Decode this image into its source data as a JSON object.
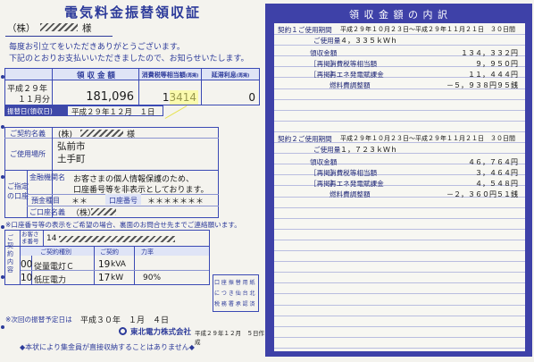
{
  "left": {
    "title": "電気料金振替領収証",
    "addressee_prefix": "（株）",
    "addressee_suffix": "様",
    "greeting_1": "毎度お引立てをいただきありがとうございます。",
    "greeting_2": "下記のとおりお支払いいただきましたので、お知らせいたします。",
    "table_headers": [
      "領 収 金 額",
      "消費税等相当額",
      "延滞利息"
    ],
    "table_header_small": [
      "(再掲)",
      "(再掲)"
    ],
    "period_year": "平成２９年",
    "period_month": "１１月分",
    "amount": "181,096",
    "tax": "13414",
    "late_interest": "0",
    "transfer_date_label": "振替日(領収日)",
    "transfer_date": "平成２９年１２月　１日",
    "contract_name_label": "ご契約名義",
    "contract_name": "(株)",
    "contract_name_suffix": "様",
    "usage_place_label": "ご使用場所",
    "usage_place_1": "弘前市",
    "usage_place_2": "土手町",
    "account_section_label": "ご指定の口座",
    "bank_label": "金融機関名",
    "privacy_note_1": "お客さまの個人情報保護のため、",
    "privacy_note_2": "口座番号等を非表示としております。",
    "deposit_type_label": "預金種目",
    "deposit_type": "＊＊",
    "account_number_label": "口座番号",
    "account_number": "＊＊＊＊＊＊＊",
    "holder_label": "ご口座名義",
    "holder": "（株）",
    "account_note": "※口座番号等の表示をご希望の場合、裏面のお問合せ先までご連絡願います。",
    "customer_number_label": "お客さま番号",
    "customer_number": "14",
    "contract_label": "ご契約内容",
    "contract_headers": [
      "ご契約種別",
      "ご契約",
      "力率"
    ],
    "contract_rows": [
      {
        "no": "00",
        "type": "従量電灯Ｃ",
        "amount": "19",
        "unit": "kVA",
        "pf": ""
      },
      {
        "no": "10",
        "type": "低圧電力",
        "amount": "17",
        "unit": "kW",
        "pf": "90%"
      }
    ],
    "stamp_lines": [
      "口 座 振 替 用 紙",
      "に つ き 仙 台 北",
      "税 務 署 承 認 済"
    ],
    "next_date_label": "※次回の振替予定日は",
    "next_date": "平成３０年　１月　４日",
    "company": "東北電力株式会社",
    "issued": "平成２９年１２月　５日作成",
    "bottom_note": "◆本状により集金員が直接収納することはありません◆"
  },
  "right": {
    "title": "領 収 金 額 の 内 訳",
    "contract1": {
      "period_label": "契約１ご使用期間",
      "period": "平成２９年１０月２３日～平成２９年１１月２１日　３０日間",
      "usage_label": "ご使用量",
      "usage": "４，３３５ｋＷｈ",
      "amount_label": "領収金額",
      "amount": "１３４，３３２円",
      "tax_label": "消費税等相当額",
      "tax": "９，９５０円",
      "renew_label": "再エネ発電賦課金",
      "renew": "１１，４４４円",
      "fuel_label": "燃料費調整額",
      "fuel": "－５，９３８円９５銭",
      "repeat": "［再掲］"
    },
    "contract2": {
      "period_label": "契約２ご使用期間",
      "period": "平成２９年１０月２３日～平成２９年１１月２１日　３０日間",
      "usage_label": "ご使用量",
      "usage": "１，７２３ｋＷｈ",
      "amount_label": "領収金額",
      "amount": "４６，７６４円",
      "tax_label": "消費税等相当額",
      "tax": "３，４６４円",
      "renew_label": "再エネ発電賦課金",
      "renew": "４，５４８円",
      "fuel_label": "燃料費調整額",
      "fuel": "－２，３６０円５１銭",
      "repeat": "［再掲］"
    }
  }
}
